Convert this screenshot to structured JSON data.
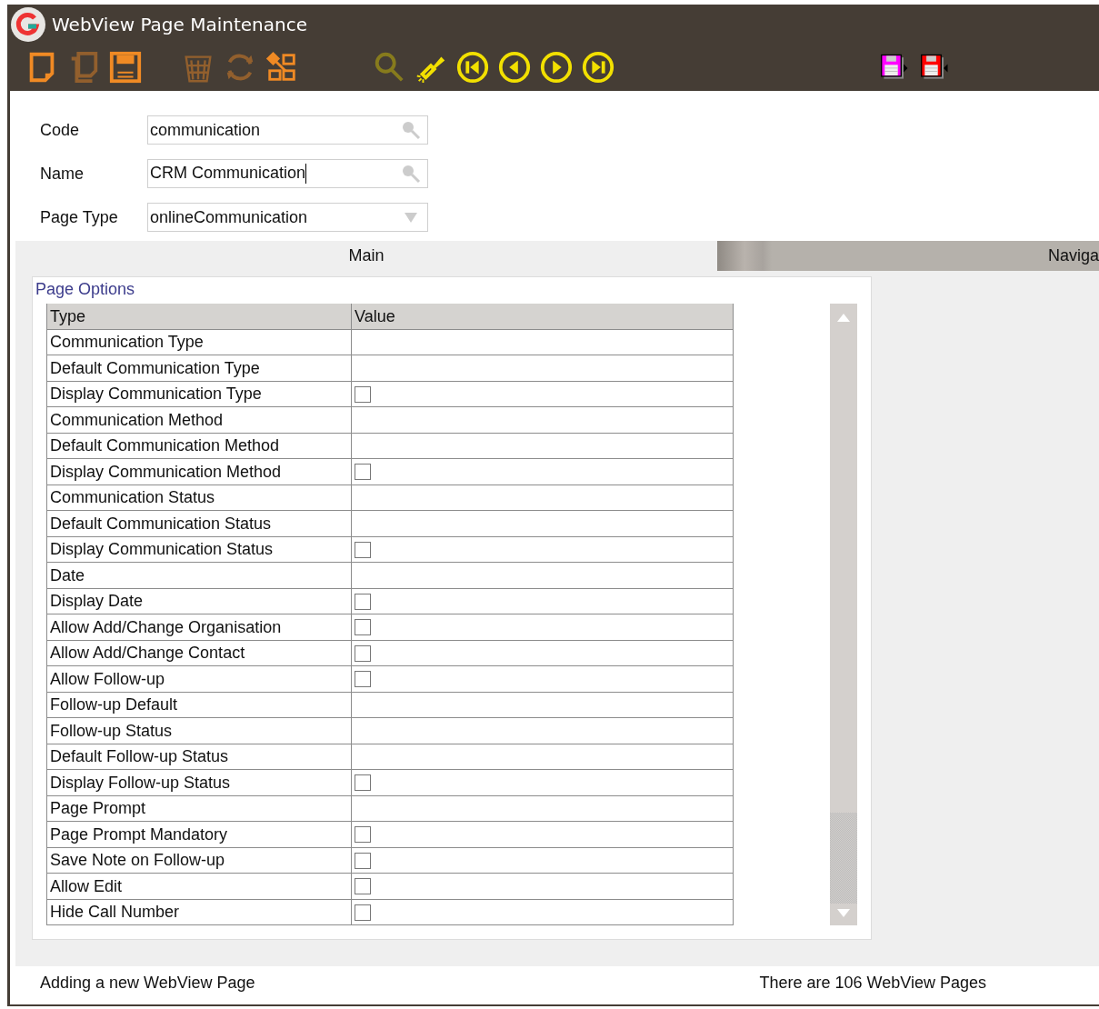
{
  "window": {
    "title": "WebView Page Maintenance"
  },
  "toolbar": [
    {
      "kind": "new",
      "disabled": false
    },
    {
      "kind": "copy",
      "disabled": true
    },
    {
      "kind": "save",
      "disabled": false
    },
    {
      "kind": "delete",
      "disabled": true
    },
    {
      "kind": "refresh",
      "disabled": true
    },
    {
      "kind": "structure",
      "disabled": false
    },
    {
      "kind": "search",
      "disabled": true
    },
    {
      "kind": "flashlight",
      "disabled": false
    },
    {
      "kind": "first",
      "disabled": false
    },
    {
      "kind": "previous",
      "disabled": false
    },
    {
      "kind": "next",
      "disabled": false
    },
    {
      "kind": "last",
      "disabled": false
    }
  ],
  "extra_toolbar": [
    {
      "kind": "save-next",
      "color": "#ff00ff"
    },
    {
      "kind": "save-previous",
      "color": "#ff0000"
    }
  ],
  "form": [
    {
      "label": "Code",
      "value": "communication",
      "kind": "lookup"
    },
    {
      "label": "Name",
      "value": "CRM Communication",
      "kind": "lookup",
      "focused": true
    },
    {
      "label": "Page Type",
      "value": "onlineCommunication",
      "kind": "dropdown"
    }
  ],
  "tabs": [
    {
      "label": "Main",
      "selected": true
    },
    {
      "label": "Naviga",
      "selected": false
    }
  ],
  "group": {
    "title": "Page Options"
  },
  "table": {
    "columns": [
      "Type",
      "Value"
    ],
    "rows": [
      {
        "type": "Communication Type",
        "kind": "text"
      },
      {
        "type": "Default Communication Type",
        "kind": "text"
      },
      {
        "type": "Display Communication Type",
        "kind": "checkbox",
        "checked": false
      },
      {
        "type": "Communication Method",
        "kind": "text"
      },
      {
        "type": "Default Communication Method",
        "kind": "text"
      },
      {
        "type": "Display Communication Method",
        "kind": "checkbox",
        "checked": false
      },
      {
        "type": "Communication Status",
        "kind": "text"
      },
      {
        "type": "Default Communication Status",
        "kind": "text"
      },
      {
        "type": "Display Communication Status",
        "kind": "checkbox",
        "checked": false
      },
      {
        "type": "Date",
        "kind": "text"
      },
      {
        "type": "Display Date",
        "kind": "checkbox",
        "checked": false
      },
      {
        "type": "Allow Add/Change Organisation",
        "kind": "checkbox",
        "checked": false
      },
      {
        "type": "Allow Add/Change Contact",
        "kind": "checkbox",
        "checked": false
      },
      {
        "type": "Allow Follow-up",
        "kind": "checkbox",
        "checked": false
      },
      {
        "type": "Follow-up Default",
        "kind": "text"
      },
      {
        "type": "Follow-up Status",
        "kind": "text"
      },
      {
        "type": "Default Follow-up Status",
        "kind": "text"
      },
      {
        "type": "Display Follow-up Status",
        "kind": "checkbox",
        "checked": false
      },
      {
        "type": "Page Prompt",
        "kind": "text"
      },
      {
        "type": "Page Prompt Mandatory",
        "kind": "checkbox",
        "checked": false
      },
      {
        "type": "Save Note on Follow-up",
        "kind": "checkbox",
        "checked": false
      },
      {
        "type": "Allow Edit",
        "kind": "checkbox",
        "checked": false
      },
      {
        "type": "Hide Call Number",
        "kind": "checkbox",
        "checked": false
      }
    ]
  },
  "status_bar": {
    "left": "Adding a new WebView Page",
    "right": "There are 106 WebView Pages"
  }
}
